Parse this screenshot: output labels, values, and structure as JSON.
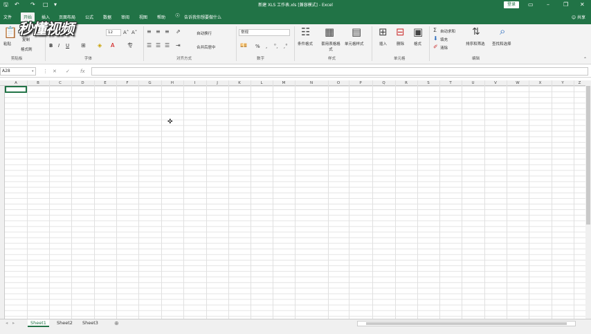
{
  "window": {
    "title": "新建 XLS 工作表.xls [兼容模式] - Excel",
    "login_label": "登录",
    "share_label": "共享"
  },
  "tabs": [
    {
      "label": "文件"
    },
    {
      "label": "开始",
      "active": true
    },
    {
      "label": "插入"
    },
    {
      "label": "页面布局"
    },
    {
      "label": "公式"
    },
    {
      "label": "数据"
    },
    {
      "label": "审阅"
    },
    {
      "label": "视图"
    },
    {
      "label": "帮助"
    },
    {
      "label": "告诉我你想要做什么"
    }
  ],
  "ribbon": {
    "clipboard": {
      "paste": "粘贴",
      "copy": "复制",
      "format_painter": "格式刷",
      "label": "剪贴板"
    },
    "font": {
      "size": "12",
      "bold": "B",
      "italic": "I",
      "underline": "U",
      "label": "字体"
    },
    "alignment": {
      "wrap": "自动换行",
      "merge": "合并后居中",
      "label": "对齐方式"
    },
    "number": {
      "format": "常规",
      "percent": "%",
      "comma": ",",
      "label": "数字"
    },
    "styles": {
      "conditional": "条件格式",
      "table": "套用表格格式",
      "cell_styles": "单元格样式",
      "label": "样式"
    },
    "cells": {
      "insert": "插入",
      "delete": "删除",
      "format": "格式",
      "label": "单元格"
    },
    "editing": {
      "autosum": "自动求和",
      "fill": "填充",
      "clear": "清除",
      "sort": "排序和筛选",
      "find": "查找和选择",
      "label": "编辑"
    }
  },
  "watermark": "秒懂视频",
  "formula_bar": {
    "name_box": "A28",
    "fx": "fx"
  },
  "columns": [
    "A",
    "B",
    "C",
    "D",
    "E",
    "F",
    "G",
    "H",
    "I",
    "J",
    "K",
    "L",
    "M",
    "N",
    "O",
    "P",
    "Q",
    "R",
    "S",
    "T",
    "U",
    "V",
    "W",
    "X",
    "Y",
    "Z"
  ],
  "sheets": [
    {
      "name": "Sheet1",
      "active": true
    },
    {
      "name": "Sheet2"
    },
    {
      "name": "Sheet3"
    }
  ],
  "new_sheet_icon": "plus-circle-icon",
  "accent_color": "#217346"
}
